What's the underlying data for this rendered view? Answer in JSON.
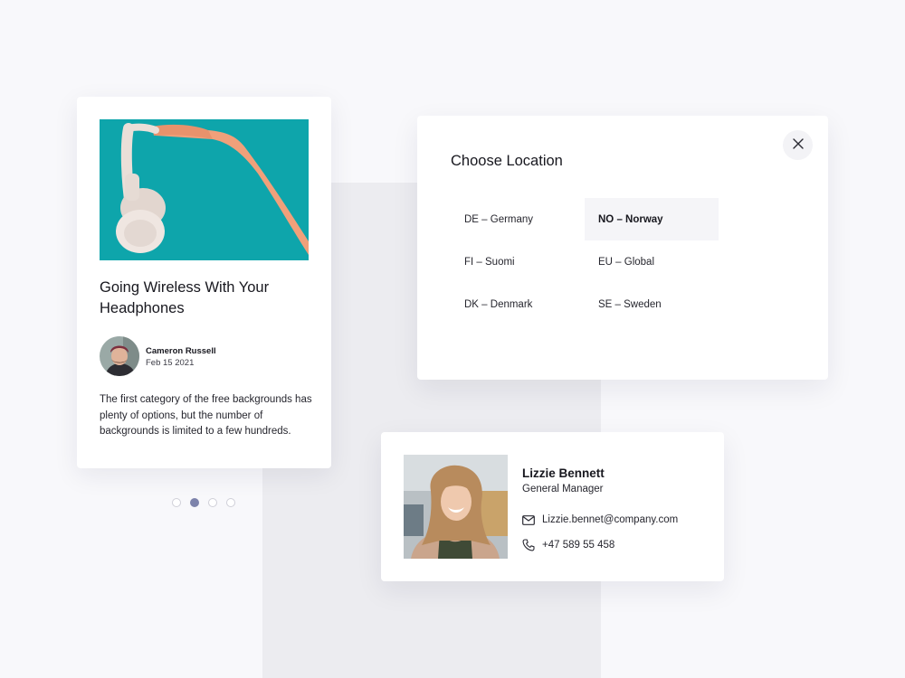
{
  "article": {
    "title": "Going Wireless With Your Headphones",
    "author_name": "Cameron Russell",
    "date": "Feb 15 2021",
    "excerpt": "The first category of the free backgrounds has plenty of options, but the number of backgrounds is limited to a few hundreds."
  },
  "pager": {
    "count": 4,
    "active_index": 1
  },
  "location_modal": {
    "title": "Choose Location",
    "options": [
      {
        "label": "DE – Germany",
        "selected": false
      },
      {
        "label": "NO – Norway",
        "selected": true
      },
      {
        "label": "FI – Suomi",
        "selected": false
      },
      {
        "label": "EU – Global",
        "selected": false
      },
      {
        "label": "DK – Denmark",
        "selected": false
      },
      {
        "label": "SE – Sweden",
        "selected": false
      }
    ]
  },
  "contact": {
    "name": "Lizzie Bennett",
    "role": "General Manager",
    "email": "Lizzie.bennet@company.com",
    "phone": "+47 589 55 458"
  },
  "icons": {
    "close": "close-icon",
    "mail": "mail-icon",
    "phone": "phone-icon"
  },
  "colors": {
    "accent_dot": "#7d83ab",
    "image_teal": "#0ea5ab"
  }
}
